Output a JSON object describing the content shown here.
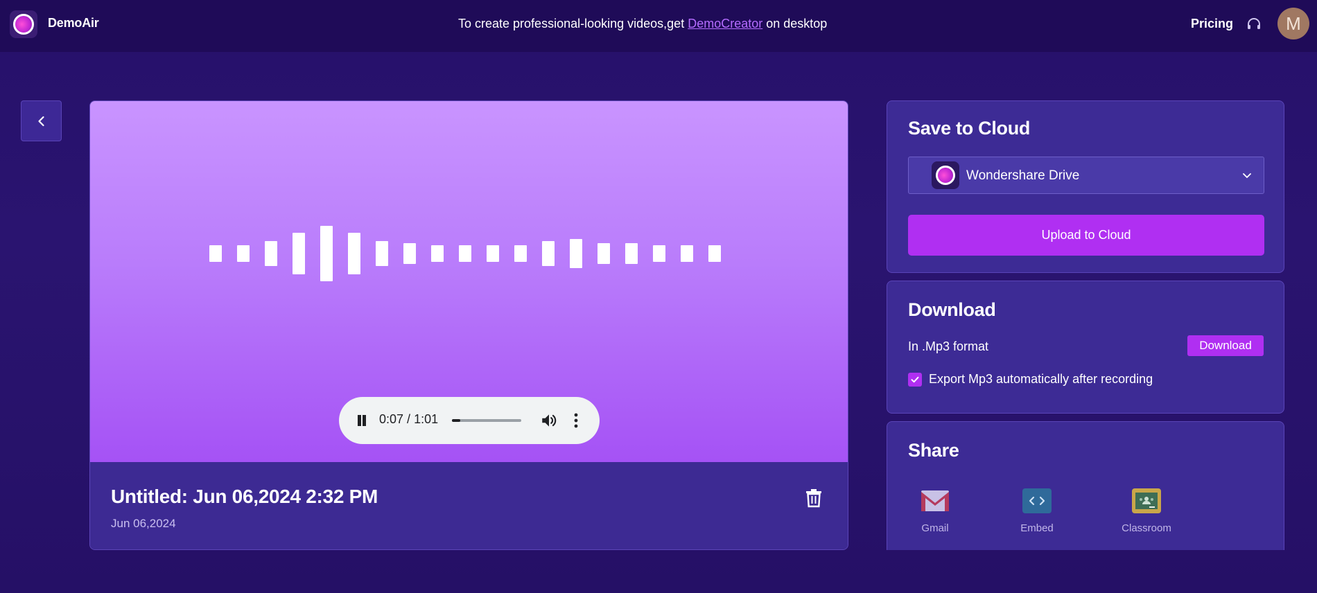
{
  "topbar": {
    "brand": "DemoAir",
    "promo_prefix": "To create professional-looking videos,get ",
    "promo_link": "DemoCreator",
    "promo_suffix": " on desktop",
    "pricing": "Pricing",
    "avatar_initial": "M"
  },
  "player": {
    "current_time": "0:07",
    "separator": " / ",
    "duration": "1:01",
    "progress_fraction": 0.115,
    "title": "Untitled: Jun 06,2024 2:32 PM",
    "date": "Jun 06,2024"
  },
  "cloud": {
    "title": "Save to Cloud",
    "provider": "Wondershare Drive",
    "upload_label": "Upload to Cloud"
  },
  "download": {
    "title": "Download",
    "format_label": "In .Mp3 format",
    "button_label": "Download",
    "auto_export_label": "Export Mp3 automatically after recording",
    "auto_export_checked": true
  },
  "share": {
    "title": "Share",
    "items": [
      {
        "label": "Gmail",
        "icon": "gmail-icon"
      },
      {
        "label": "Embed",
        "icon": "embed-icon"
      },
      {
        "label": "Classroom",
        "icon": "classroom-icon"
      }
    ]
  },
  "colors": {
    "accent": "#b02ff2",
    "background": "#26106a",
    "topbar": "#1f0b58",
    "panel": "#3d2b95"
  }
}
